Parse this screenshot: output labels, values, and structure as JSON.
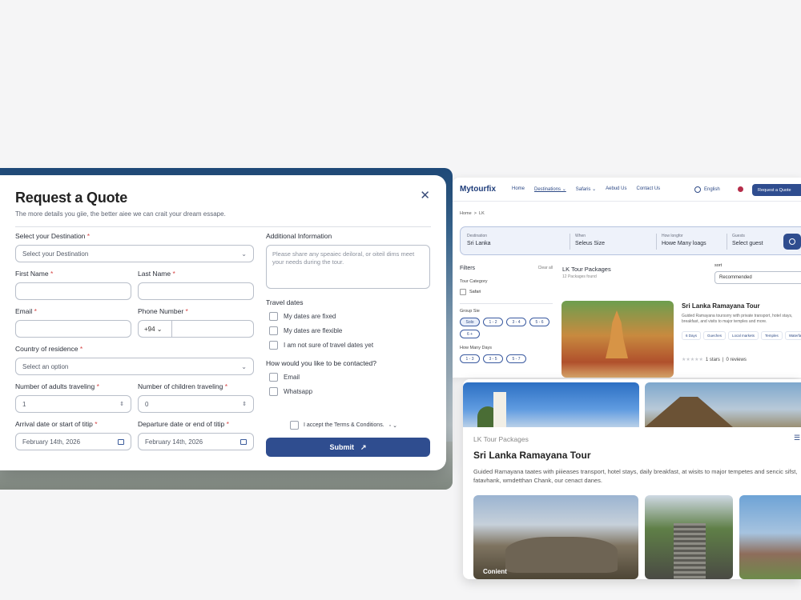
{
  "modal": {
    "title": "Request a Quote",
    "subtitle": "The more details you giie, the better aiee we can crait your dream essape.",
    "destination": {
      "label": "Select your Destination",
      "placeholder": "Select your Destination"
    },
    "first_name": {
      "label": "First Name"
    },
    "last_name": {
      "label": "Last Name"
    },
    "email": {
      "label": "Email"
    },
    "phone": {
      "label": "Phone Number",
      "code": "+94"
    },
    "country": {
      "label": "Country of residence",
      "placeholder": "Select an option"
    },
    "adults": {
      "label": "Number of adults traveling",
      "value": "1"
    },
    "children": {
      "label": "Number of children traveling",
      "value": "0"
    },
    "arrival": {
      "label": "Arrival date or start of titip",
      "value": "February 14th, 2026"
    },
    "departure": {
      "label": "Departure date or end of titip",
      "value": "February 14th, 2026"
    },
    "additional": {
      "label": "Additional Information",
      "placeholder": "Please share any speaiec deiloral, or oiteil dims meet your needs during the tour."
    },
    "travel_dates": {
      "label": "Travel dates",
      "options": [
        "My dates are fixed",
        "My dates are flexible",
        "I am not sure of travel dates yet"
      ]
    },
    "contact": {
      "label": "How would you like to be contacted?",
      "options": [
        "Email",
        "Whatsapp"
      ]
    },
    "terms": "I accept the Terms & Conditions.",
    "submit": "Submit",
    "required_mark": "*",
    "arrow": "↗"
  },
  "site": {
    "logo": "Mytourfix",
    "nav": [
      "Home",
      "Destinations",
      "Safaris",
      "Aebud Us",
      "Contact Us"
    ],
    "language": "English",
    "quote_button": "Request a Quote",
    "breadcrumb": [
      "Home",
      ">",
      "LK"
    ],
    "search": {
      "destination_label": "Destination",
      "destination_value": "Sri Lanka",
      "when_label": "When",
      "when_value": "Seleus Size",
      "duration_label": "How longfor",
      "duration_value": "Howe Many loags",
      "guests_label": "Guests",
      "guests_value": "Select guest"
    },
    "filters": {
      "title": "Filters",
      "clear": "Clear all",
      "category_label": "Tour Category",
      "category_option": "Safari",
      "group_label": "Group Sie",
      "group_options": [
        "Solo",
        "1 - 2",
        "3 - 4",
        "5 - 6",
        "6 +"
      ],
      "days_label": "How Many Days",
      "days_options": [
        "1 - 3",
        "3 - 5",
        "5 - 7"
      ]
    },
    "results": {
      "title": "LK Tour Packages",
      "count": "12 Packages found",
      "sort_label": "sort",
      "sort_value": "Recommended"
    },
    "card": {
      "title": "Sri Lanka Ramayana Tour",
      "desc": "Guided Ramayana tourssrry with private transport, hotel stays, breakfast, and visits to major temples and more.",
      "tags": [
        "6 Days",
        "Gueches",
        "Local markets",
        "Temples",
        "Waterfalls"
      ],
      "rating": "1 stars",
      "reviews": "0 reviews"
    }
  },
  "detail": {
    "subtitle": "LK Tour Packages",
    "title": "Sri Lanka Ramayana Tour",
    "desc": "Guided Ramayana taates with piiieases transport, hotel stays, daily breakfast, at wisits to major tempetes and sencic sifst, fatavhank, wmdetthan Chank, our cenact danes.",
    "gallery_label": "Conient"
  },
  "colors": {
    "primary": "#2f4d8f",
    "required": "#d64545"
  }
}
